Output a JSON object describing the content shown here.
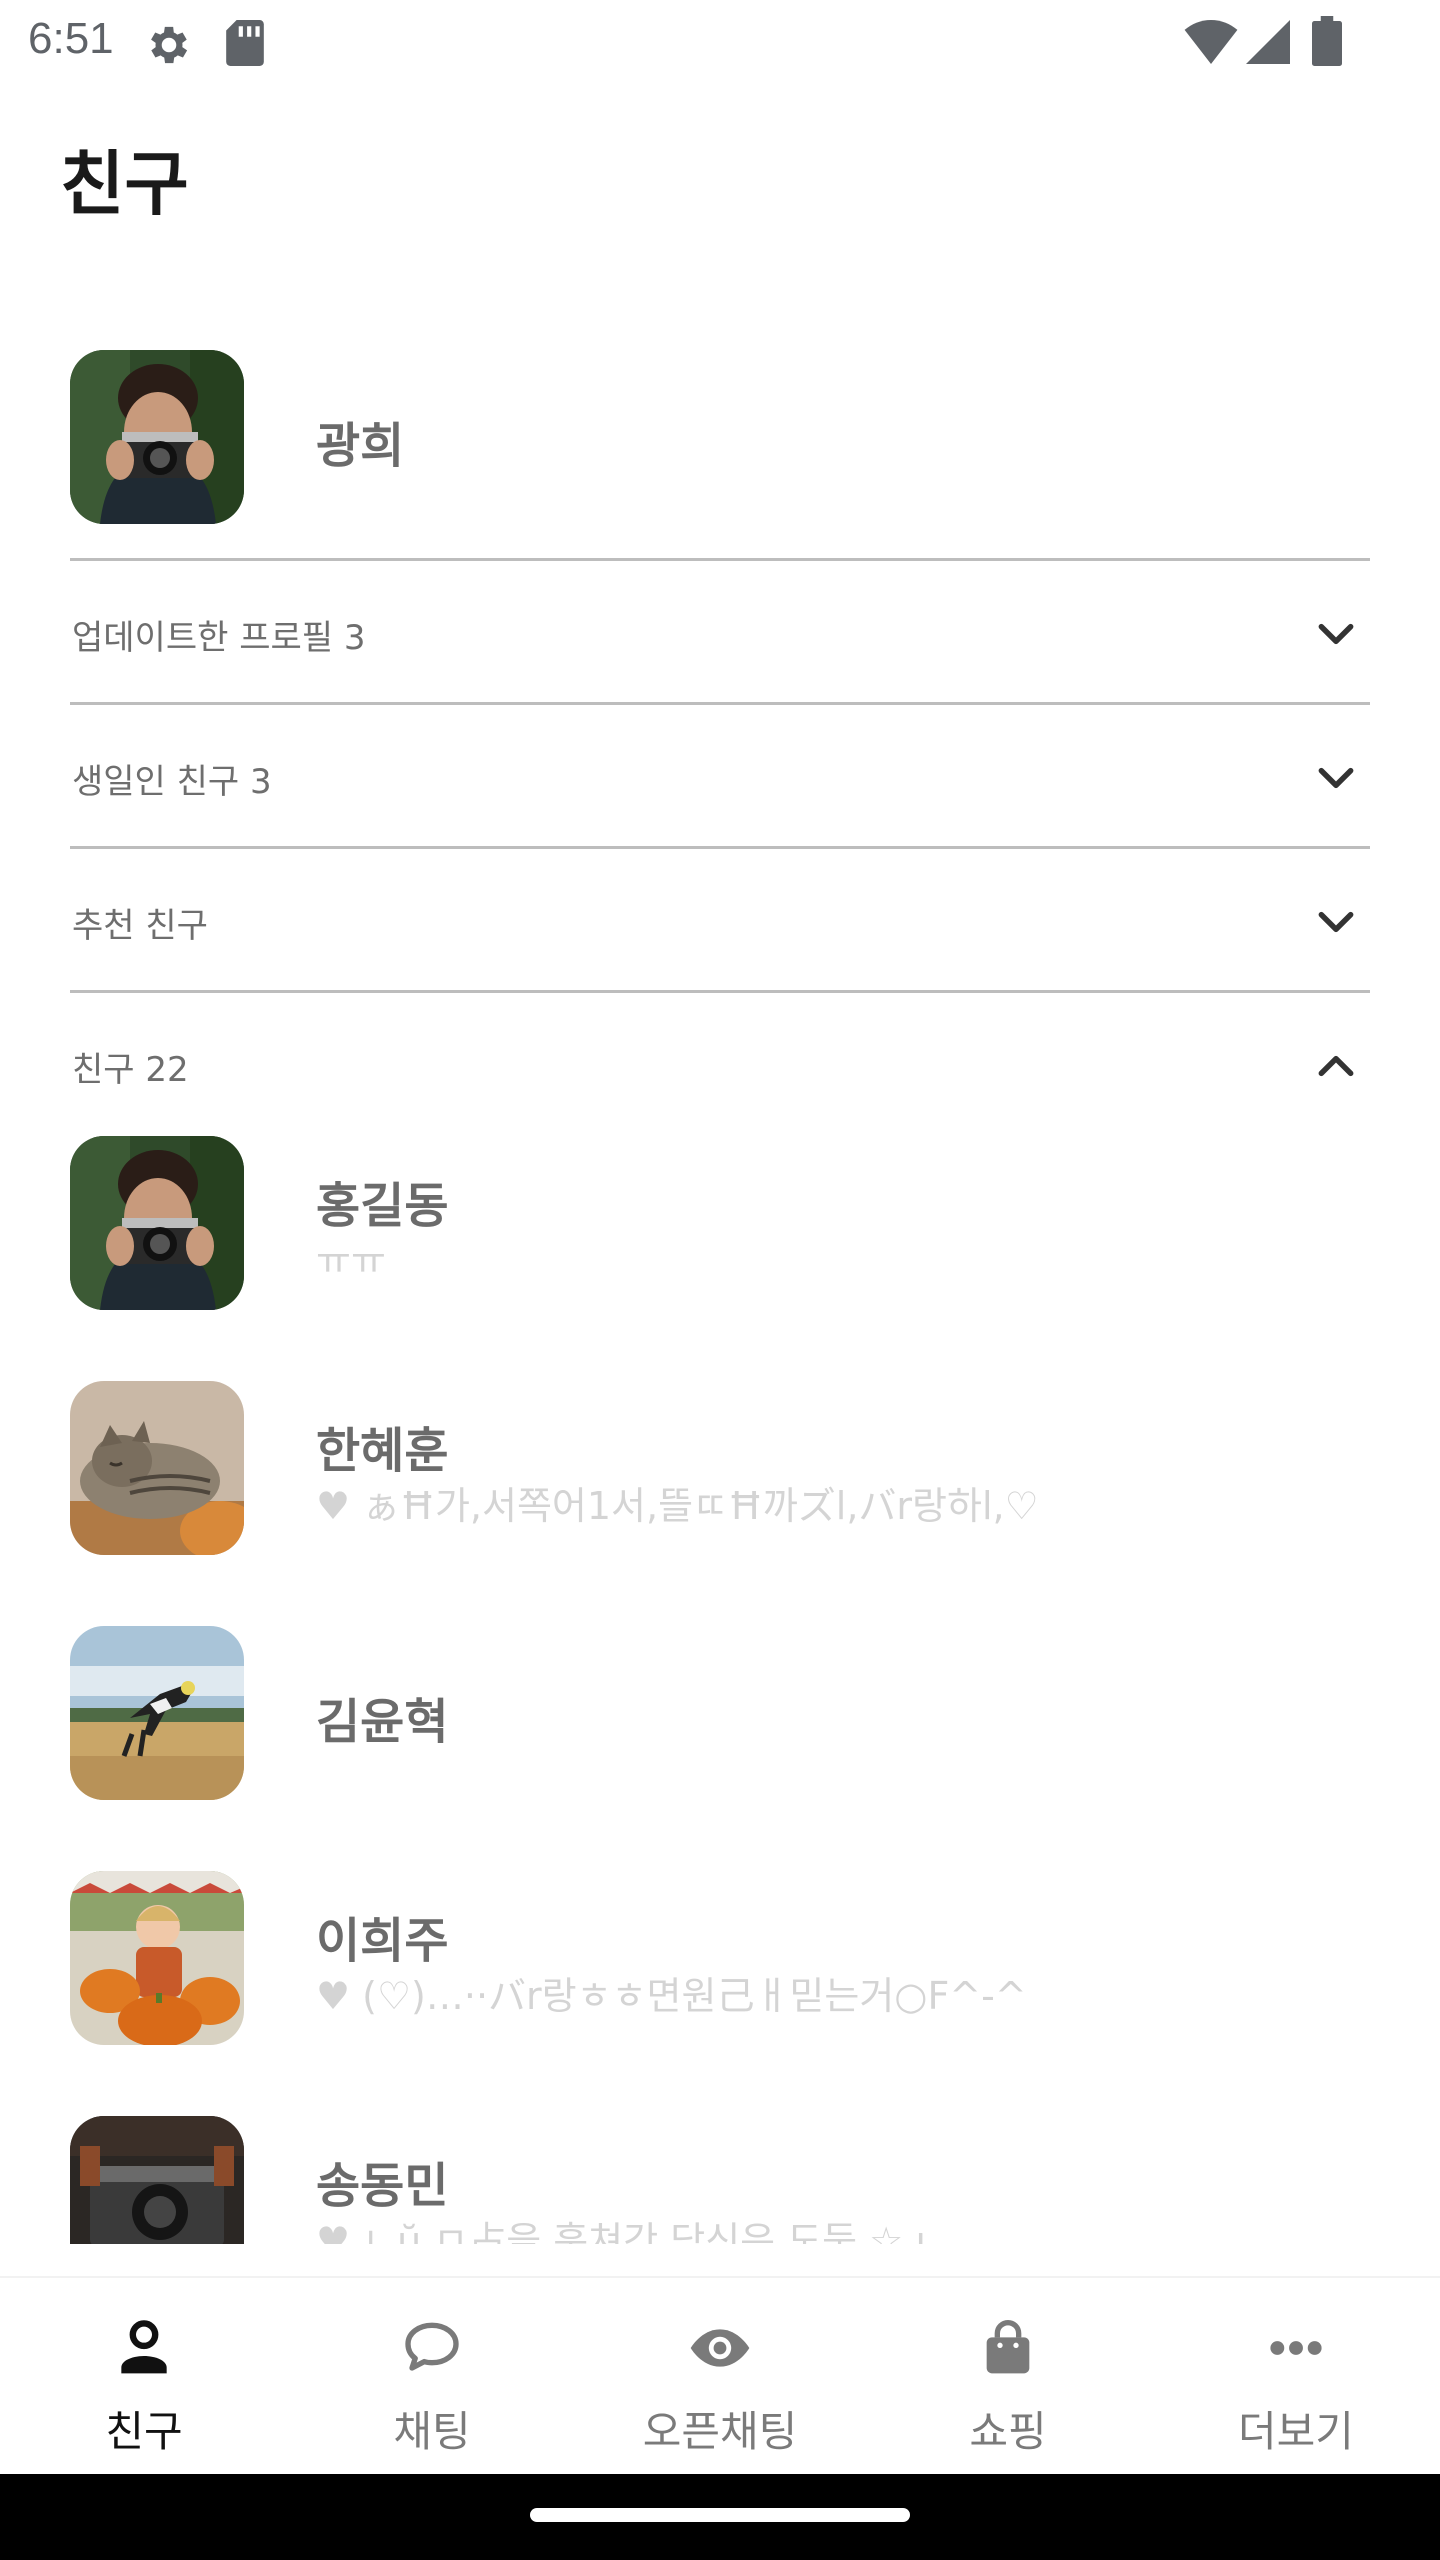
{
  "status_bar": {
    "time": "6:51",
    "icons": [
      "gear-icon",
      "sd-card-icon",
      "wifi-icon",
      "signal-icon",
      "battery-icon"
    ]
  },
  "header": {
    "title": "친구"
  },
  "my_profile": {
    "name": "광희",
    "avatar": "camera-boy-photo"
  },
  "sections": [
    {
      "label": "업데이트한 프로필 3",
      "expanded": false
    },
    {
      "label": "생일인 친구 3",
      "expanded": false
    },
    {
      "label": "추천 친구",
      "expanded": false
    },
    {
      "label": "친구 22",
      "expanded": true
    }
  ],
  "friends": [
    {
      "name": "홍길동",
      "status": "ㅠㅠ",
      "avatar": "camera-boy-photo"
    },
    {
      "name": "한혜훈",
      "status": "♥ ぁĦ가,서쪽어1서,뜰ㄸĦ까ズl,バr랑하l,♡",
      "avatar": "sleeping-cat-photo"
    },
    {
      "name": "김윤혁",
      "status": "",
      "avatar": "jumping-dog-photo"
    },
    {
      "name": "이희주",
      "status": "♥ (♡)…··バr랑ㅎㅎ면원己ㅐ믿는거○F^-^",
      "avatar": "child-pumpkins-photo"
    },
    {
      "name": "송동민",
      "status": "♥ ㄴŭ ㅁ占을 훔쳐간 당신은 도둑 ☆ ı",
      "avatar": "vintage-camera-photo"
    }
  ],
  "bottom_nav": [
    {
      "label": "친구",
      "icon": "person-icon",
      "active": true
    },
    {
      "label": "채팅",
      "icon": "chat-bubble-icon",
      "active": false
    },
    {
      "label": "오픈채팅",
      "icon": "eye-icon",
      "active": false
    },
    {
      "label": "쇼핑",
      "icon": "shopping-bag-icon",
      "active": false
    },
    {
      "label": "더보기",
      "icon": "more-dots-icon",
      "active": false
    }
  ],
  "colors": {
    "name_text": "#6b6b6b",
    "status_text": "#d4d4d4",
    "divider": "#bdbdbd",
    "active_nav": "#111111",
    "inactive_nav": "#7a7a7a"
  }
}
